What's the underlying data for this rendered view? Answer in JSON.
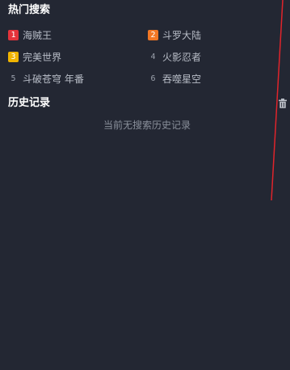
{
  "hot_search": {
    "title": "热门搜索",
    "items": [
      {
        "rank": "1",
        "label": "海贼王",
        "rank_color": "#e4333b",
        "highlight": true
      },
      {
        "rank": "2",
        "label": "斗罗大陆",
        "rank_color": "#f27724",
        "highlight": true
      },
      {
        "rank": "3",
        "label": "完美世界",
        "rank_color": "#f0b400",
        "highlight": true
      },
      {
        "rank": "4",
        "label": "火影忍者",
        "rank_color": "",
        "highlight": false
      },
      {
        "rank": "5",
        "label": "斗破苍穹 年番",
        "rank_color": "",
        "highlight": false
      },
      {
        "rank": "6",
        "label": "吞噬星空",
        "rank_color": "",
        "highlight": false
      }
    ]
  },
  "history": {
    "title": "历史记录",
    "empty_text": "当前无搜索历史记录",
    "clear_icon": "trash-icon"
  },
  "colors": {
    "background": "#232733",
    "title": "#ffffff",
    "red_line": "#e0242b"
  }
}
